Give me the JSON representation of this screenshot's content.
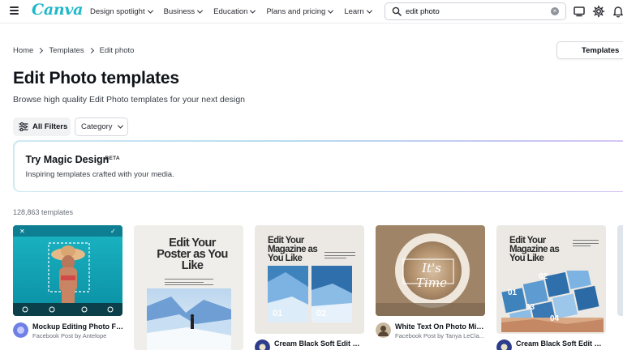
{
  "brand": {
    "logo": "Canva",
    "accent": "#20b8c9"
  },
  "nav": {
    "items": [
      "Design spotlight",
      "Business",
      "Education",
      "Plans and pricing",
      "Learn"
    ]
  },
  "search": {
    "value": "edit photo",
    "placeholder": "Search"
  },
  "icons": {
    "menu": "hamburger-icon",
    "search": "search-icon",
    "clear": "clear-icon",
    "desktop": "desktop-icon",
    "settings": "gear-icon",
    "notifications": "bell-icon"
  },
  "breadcrumb": [
    "Home",
    "Templates",
    "Edit photo"
  ],
  "templates_button": "Templates",
  "page": {
    "title": "Edit Photo templates",
    "subtitle": "Browse high quality Edit Photo templates for your next design"
  },
  "filters": {
    "all": "All Filters",
    "category": "Category"
  },
  "magic": {
    "title": "Try Magic Design",
    "badge": "BETA",
    "description": "Inspiring templates crafted with your media."
  },
  "count": "128,863 templates",
  "cards": [
    {
      "name": "Mockup Editing Photo Fa...",
      "by": "Facebook Post by Antelope"
    },
    {
      "name": "",
      "by": "",
      "headline": "Edit Your Poster as You Like"
    },
    {
      "name": "Cream Black Soft Edit Ma...",
      "by": "",
      "headline": "Edit Your Magazine as You Like"
    },
    {
      "name": "White Text On Photo Mini...",
      "by": "Facebook Post by Tanya LeCla...",
      "headline": "It's Time"
    },
    {
      "name": "Cream Black Soft Edit Ma...",
      "by": "",
      "headline": "Edit Your Magazine as You Like"
    }
  ],
  "card_numbers": [
    "01",
    "02",
    "01",
    "02",
    "03",
    "04"
  ]
}
